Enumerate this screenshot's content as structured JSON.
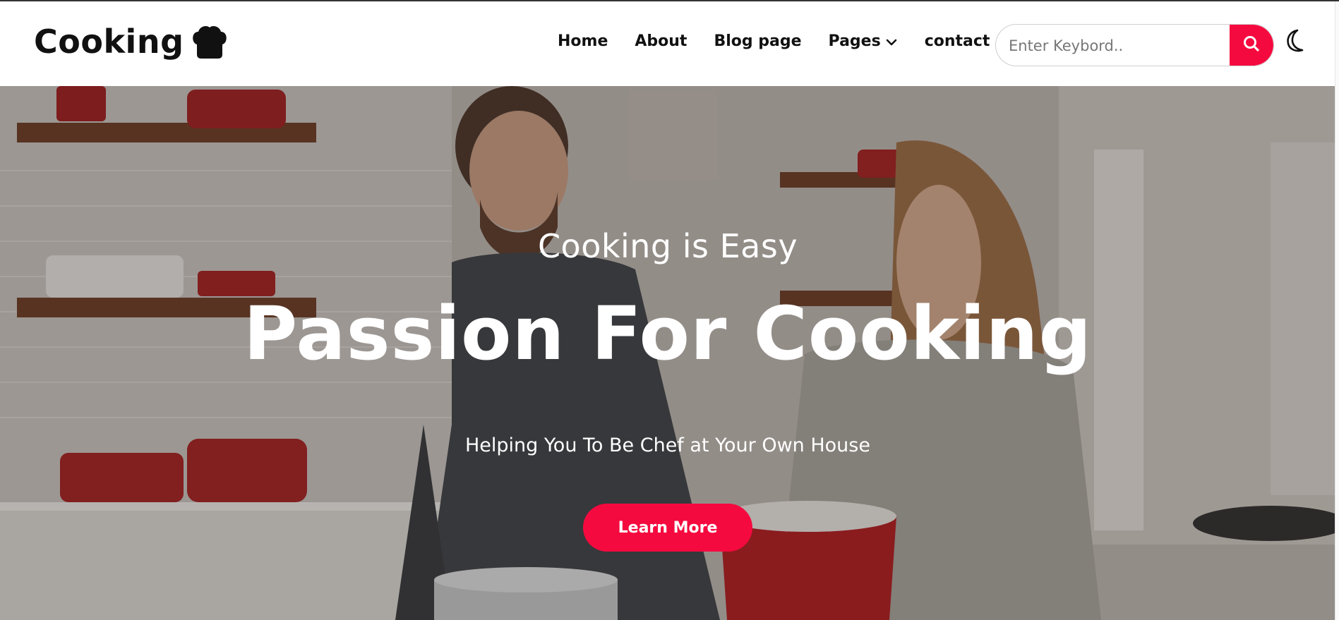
{
  "header": {
    "logo_text": "Cooking",
    "logo_icon": "chef-hat-icon",
    "nav": [
      {
        "label": "Home"
      },
      {
        "label": "About"
      },
      {
        "label": "Blog page"
      },
      {
        "label": "Pages",
        "has_dropdown": true
      },
      {
        "label": "contact"
      }
    ],
    "search": {
      "placeholder": "Enter Keybord..",
      "value": "",
      "button_icon": "search-icon"
    },
    "theme_toggle_icon": "moon-icon"
  },
  "hero": {
    "subtitle": "Cooking is Easy",
    "title": "Passion For Cooking",
    "tagline": "Helping You To Be Chef at Your Own House",
    "cta_label": "Learn More"
  },
  "colors": {
    "accent": "#f50a3f",
    "text_dark": "#111111",
    "hero_text": "#ffffff"
  }
}
